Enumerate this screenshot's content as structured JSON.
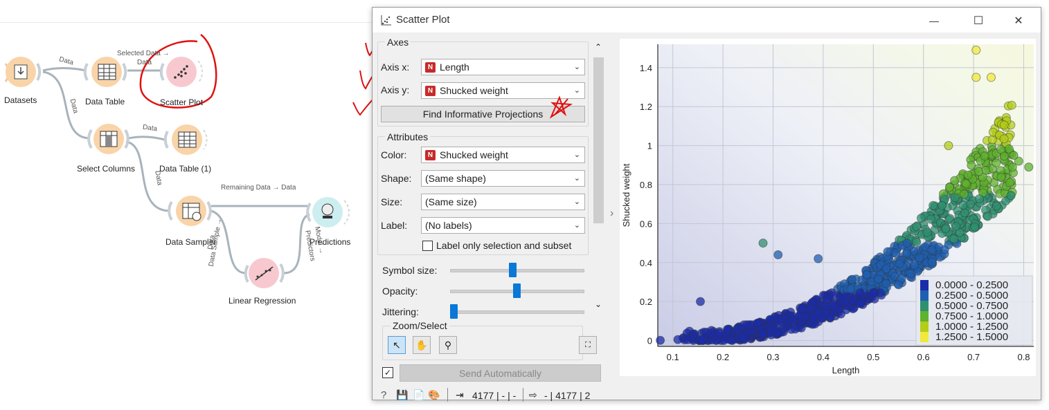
{
  "workflow": {
    "nodes": [
      {
        "id": "datasets",
        "label": "Datasets"
      },
      {
        "id": "data_table",
        "label": "Data Table"
      },
      {
        "id": "scatter_plot",
        "label": "Scatter Plot"
      },
      {
        "id": "select_columns",
        "label": "Select Columns"
      },
      {
        "id": "data_table_1",
        "label": "Data Table (1)"
      },
      {
        "id": "data_sampler",
        "label": "Data Sampler"
      },
      {
        "id": "predictions",
        "label": "Predictions"
      },
      {
        "id": "linear_regression",
        "label": "Linear Regression"
      }
    ],
    "links": {
      "datasets_table": "Data",
      "datasets_select": "Data",
      "table_scatter_1": "Selected Data →",
      "table_scatter_2": "Data",
      "select_table1": "Data",
      "select_sampler": "Data",
      "sampler_predictions": "Remaining Data → Data",
      "sampler_lr_1": "Data Sample →",
      "sampler_lr_2": "Data",
      "lr_predictions_1": "Model →",
      "lr_predictions_2": "Predictors"
    }
  },
  "window": {
    "title": "Scatter Plot",
    "controls": {
      "minimize": "—",
      "maximize": "☐",
      "close": "✕"
    }
  },
  "axes_group": {
    "title": "Axes",
    "axis_x_label": "Axis x:",
    "axis_x_value": "Length",
    "axis_y_label": "Axis y:",
    "axis_y_value": "Shucked weight",
    "find_button": "Find Informative Projections"
  },
  "attributes_group": {
    "title": "Attributes",
    "color_label": "Color:",
    "color_value": "Shucked weight",
    "shape_label": "Shape:",
    "shape_value": "(Same shape)",
    "size_label": "Size:",
    "size_value": "(Same size)",
    "label_label": "Label:",
    "label_value": "(No labels)",
    "label_only_checkbox": "Label only selection and subset",
    "label_only_checked": false
  },
  "sliders": {
    "symbol_size_label": "Symbol size:",
    "symbol_size_level": 0.47,
    "opacity_label": "Opacity:",
    "opacity_level": 0.5,
    "jittering_label": "Jittering:",
    "jittering_level": 0.0
  },
  "zoom_group": {
    "title": "Zoom/Select"
  },
  "send": {
    "label": "Send Automatically",
    "checked": true
  },
  "status": {
    "input_summary": "4177 | - | -",
    "output_summary": "- | 4177 | 2"
  },
  "chart_data": {
    "type": "scatter",
    "xlabel": "Length",
    "ylabel": "Shucked weight",
    "xlim": [
      0.07,
      0.82
    ],
    "ylim": [
      -0.03,
      1.52
    ],
    "xticks": [
      "0.1",
      "0.2",
      "0.3",
      "0.4",
      "0.5",
      "0.6",
      "0.7",
      "0.8"
    ],
    "yticks": [
      "0",
      "0.2",
      "0.4",
      "0.6",
      "0.8",
      "1",
      "1.2",
      "1.4"
    ],
    "grid": true,
    "legend_position": "bottom-right",
    "legend": [
      {
        "label": "0.0000 - 0.2500",
        "color": "#1b2ca8"
      },
      {
        "label": "0.2500 - 0.5000",
        "color": "#1f5fb0"
      },
      {
        "label": "0.5000 - 0.7500",
        "color": "#2f9070"
      },
      {
        "label": "0.7500 - 1.0000",
        "color": "#5fb22d"
      },
      {
        "label": "1.0000 - 1.2500",
        "color": "#b4cd17"
      },
      {
        "label": "1.2500 - 1.5000",
        "color": "#f0e93b"
      }
    ],
    "outlier_points": [
      {
        "x": 0.075,
        "y": 0.001
      },
      {
        "x": 0.11,
        "y": 0.005
      },
      {
        "x": 0.13,
        "y": 0.004
      },
      {
        "x": 0.155,
        "y": 0.2
      },
      {
        "x": 0.28,
        "y": 0.5
      },
      {
        "x": 0.31,
        "y": 0.44
      },
      {
        "x": 0.39,
        "y": 0.42
      },
      {
        "x": 0.81,
        "y": 0.89
      },
      {
        "x": 0.79,
        "y": 0.92
      },
      {
        "x": 0.705,
        "y": 1.49
      },
      {
        "x": 0.735,
        "y": 1.35
      },
      {
        "x": 0.705,
        "y": 1.35
      },
      {
        "x": 0.65,
        "y": 1.0
      },
      {
        "x": 0.78,
        "y": 0.95
      }
    ],
    "trend": {
      "description": "dense cloud: y ≈ 0.015 + 2.4 * max(0, x-0.1)^2.3",
      "n_points": 4177
    }
  }
}
